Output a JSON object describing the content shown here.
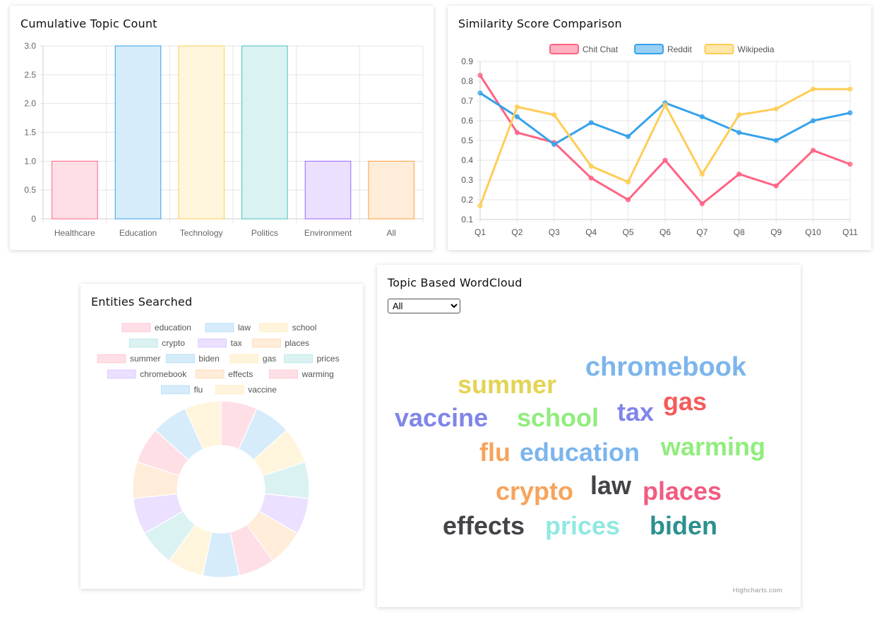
{
  "colors": {
    "pink": "#ff6384",
    "blue": "#36a2eb",
    "yellow": "#ffcd56",
    "teal": "#4bc0c0",
    "purple": "#9966ff",
    "orange": "#ff9f40",
    "pink_fill": "#ffdfe6",
    "blue_fill": "#d7ecfb",
    "yellow_fill": "#fff5dd",
    "teal_fill": "#dbf2f2",
    "purple_fill": "#ebe0ff",
    "orange_fill": "#ffecd9"
  },
  "bar_card": {
    "title": "Cumulative Topic Count"
  },
  "line_card": {
    "title": "Similarity Score Comparison"
  },
  "donut_card": {
    "title": "Entities Searched"
  },
  "cloud_card": {
    "title": "Topic Based WordCloud",
    "select_value": "All",
    "credits": "Highcharts.com"
  },
  "chart_data": [
    {
      "type": "bar",
      "categories": [
        "Healthcare",
        "Education",
        "Technology",
        "Politics",
        "Environment",
        "All"
      ],
      "values": [
        1,
        3,
        3,
        3,
        1,
        1
      ],
      "ylim": [
        0,
        3
      ],
      "yticks": [
        "0",
        "0.5",
        "1.0",
        "1.5",
        "2.0",
        "2.5",
        "3.0"
      ],
      "grid": true
    },
    {
      "type": "line",
      "categories": [
        "Q1",
        "Q2",
        "Q3",
        "Q4",
        "Q5",
        "Q6",
        "Q7",
        "Q8",
        "Q9",
        "Q10",
        "Q11"
      ],
      "series": [
        {
          "name": "Chit Chat",
          "color": "#ff6384",
          "values": [
            0.83,
            0.54,
            0.49,
            0.31,
            0.2,
            0.4,
            0.18,
            0.33,
            0.27,
            0.45,
            0.38
          ]
        },
        {
          "name": "Reddit",
          "color": "#36a2eb",
          "values": [
            0.74,
            0.62,
            0.48,
            0.59,
            0.52,
            0.69,
            0.62,
            0.54,
            0.5,
            0.6,
            0.64
          ]
        },
        {
          "name": "Wikipedia",
          "color": "#ffcd56",
          "values": [
            0.17,
            0.67,
            0.63,
            0.37,
            0.29,
            0.68,
            0.33,
            0.63,
            0.66,
            0.76,
            0.76
          ]
        }
      ],
      "ylim": [
        0.1,
        0.9
      ],
      "yticks": [
        "0.1",
        "0.2",
        "0.3",
        "0.4",
        "0.5",
        "0.6",
        "0.7",
        "0.8",
        "0.9"
      ],
      "legend": "top",
      "grid": true
    },
    {
      "type": "pie",
      "labels": [
        "education",
        "law",
        "school",
        "crypto",
        "tax",
        "places",
        "summer",
        "biden",
        "gas",
        "prices",
        "chromebook",
        "effects",
        "warming",
        "flu",
        "vaccine"
      ],
      "values": [
        1,
        1,
        1,
        1,
        1,
        1,
        1,
        1,
        1,
        1,
        1,
        1,
        1,
        1,
        1
      ],
      "legend": "top"
    },
    {
      "type": "wordcloud",
      "words": [
        {
          "text": "chromebook",
          "color": "#7cb5ec"
        },
        {
          "text": "summer",
          "color": "#e4d354"
        },
        {
          "text": "gas",
          "color": "#f45b5b"
        },
        {
          "text": "vaccine",
          "color": "#8085e9"
        },
        {
          "text": "school",
          "color": "#90ed7d"
        },
        {
          "text": "tax",
          "color": "#8085e9"
        },
        {
          "text": "flu",
          "color": "#f7a35c"
        },
        {
          "text": "education",
          "color": "#7cb5ec"
        },
        {
          "text": "warming",
          "color": "#90ed7d"
        },
        {
          "text": "crypto",
          "color": "#f7a35c"
        },
        {
          "text": "law",
          "color": "#434348"
        },
        {
          "text": "places",
          "color": "#f15c80"
        },
        {
          "text": "effects",
          "color": "#434348"
        },
        {
          "text": "prices",
          "color": "#91e8e1"
        },
        {
          "text": "biden",
          "color": "#2b908f"
        }
      ]
    }
  ]
}
